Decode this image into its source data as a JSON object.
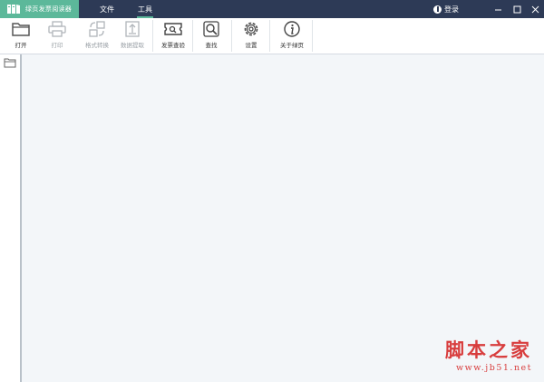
{
  "app": {
    "title": "绿页发票阅读器",
    "accent_color": "#5cb89a",
    "titlebar_color": "#2d3a56"
  },
  "menu": {
    "file": "文件",
    "tools": "工具",
    "active": "tools"
  },
  "account": {
    "login_label": "登录",
    "login_icon": "user-info-icon"
  },
  "window_controls": {
    "minimize": "minimize-icon",
    "maximize": "maximize-icon",
    "close": "close-icon"
  },
  "toolbar": {
    "open": {
      "label": "打开",
      "icon": "folder-open-icon",
      "enabled": true
    },
    "print": {
      "label": "打印",
      "icon": "printer-icon",
      "enabled": false
    },
    "convert": {
      "label": "格式转换",
      "icon": "format-convert-icon",
      "enabled": false
    },
    "extract": {
      "label": "数据提取",
      "icon": "data-extract-icon",
      "enabled": false
    },
    "verify": {
      "label": "发票查验",
      "icon": "invoice-verify-icon",
      "enabled": true
    },
    "find": {
      "label": "查找",
      "icon": "search-icon",
      "enabled": true
    },
    "settings": {
      "label": "设置",
      "icon": "gear-icon",
      "enabled": true
    },
    "about": {
      "label": "关于绿页",
      "icon": "info-icon",
      "enabled": true
    }
  },
  "sidepanel": {
    "icon": "folder-icon"
  },
  "watermark": {
    "title": "脚本之家",
    "url": "www.jb51.net"
  }
}
